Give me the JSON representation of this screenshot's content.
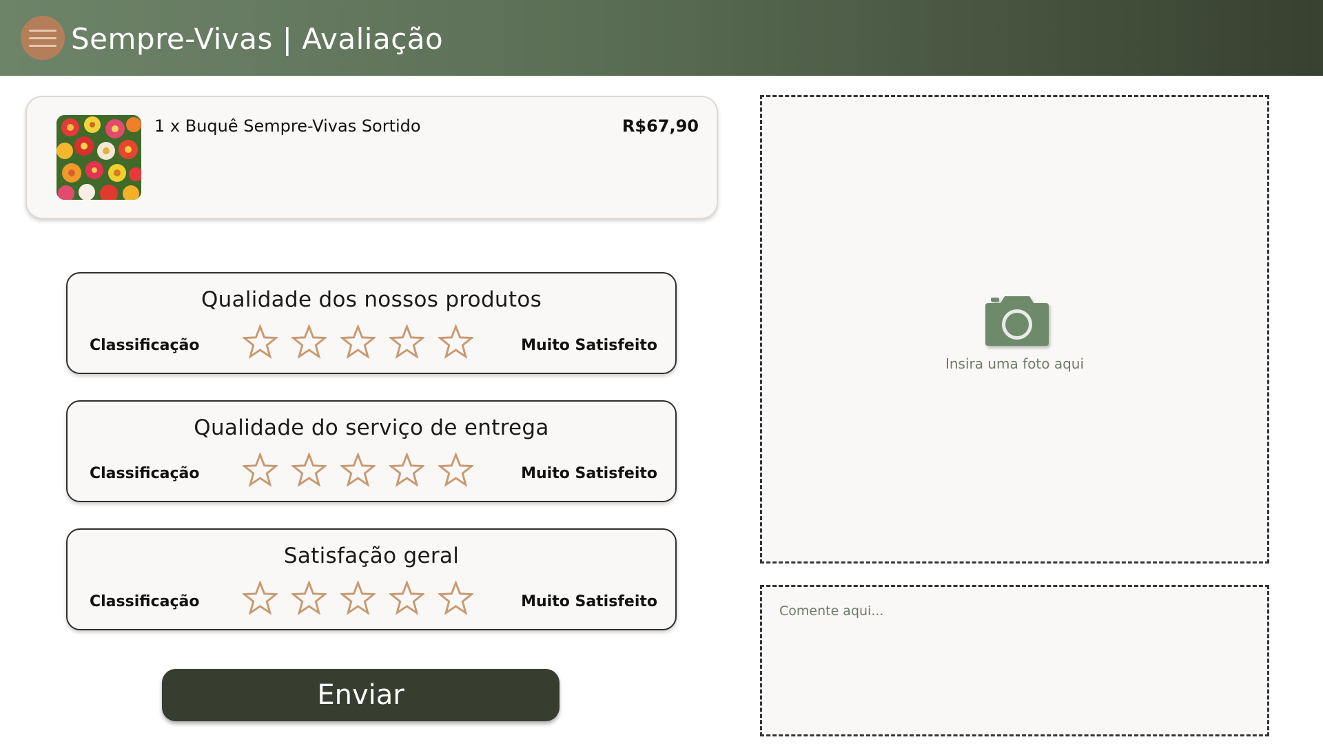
{
  "header": {
    "title": "Sempre-Vivas | Avaliação"
  },
  "product": {
    "name": "1 x Buquê Sempre-Vivas Sortido",
    "price": "R$67,90"
  },
  "ratings": [
    {
      "title": "Qualidade dos nossos produtos",
      "left_label": "Classificação",
      "right_label": "Muito Satisfeito",
      "stars": 5,
      "selected": 0
    },
    {
      "title": "Qualidade do serviço de entrega",
      "left_label": "Classificação",
      "right_label": "Muito Satisfeito",
      "stars": 5,
      "selected": 0
    },
    {
      "title": "Satisfação geral",
      "left_label": "Classificação",
      "right_label": "Muito Satisfeito",
      "stars": 5,
      "selected": 0
    }
  ],
  "submit": {
    "label": "Enviar"
  },
  "photo": {
    "label": "Insira uma foto aqui",
    "icon": "camera-icon"
  },
  "comment": {
    "placeholder": "Comente aqui...",
    "value": ""
  },
  "colors": {
    "header_start": "#6e8469",
    "header_end": "#38402f",
    "menu_button": "#b57e5b",
    "star_outline": "#c79a72",
    "button": "#373e2f",
    "camera": "#6e8a6b",
    "muted_text": "#6c7b69"
  }
}
